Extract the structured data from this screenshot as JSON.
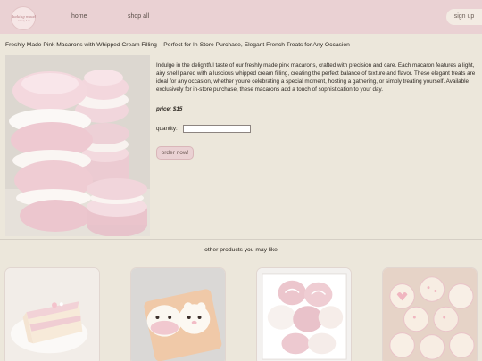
{
  "brand": {
    "logo_text": "baking mood",
    "logo_sub": "bakery & co"
  },
  "nav": {
    "home": "home",
    "shop_all": "shop all",
    "sign_up": "sign up"
  },
  "product": {
    "title": "Freshly Made Pink Macarons with Whipped Cream Filling – Perfect for In-Store Purchase, Elegant French Treats for Any Occasion",
    "description": "Indulge in the delightful taste of our freshly made pink macarons, crafted with precision and care. Each macaron features a light, airy shell paired with a luscious whipped cream filling, creating the perfect balance of texture and flavor. These elegant treats are ideal for any occasion, whether you're celebrating a special moment, hosting a gathering, or simply treating yourself. Available exclusively for in-store purchase, these macarons add a touch of sophistication to your day.",
    "price": "price: $15",
    "quantity_label": "quantity:",
    "quantity_value": "",
    "order_button": "order now!"
  },
  "related": {
    "heading": "other products you may like"
  },
  "colors": {
    "header_bg": "#ead1d3",
    "page_bg": "#ece7db",
    "macaron_pink": "#f1d3da",
    "cream": "#fbf8f6"
  }
}
